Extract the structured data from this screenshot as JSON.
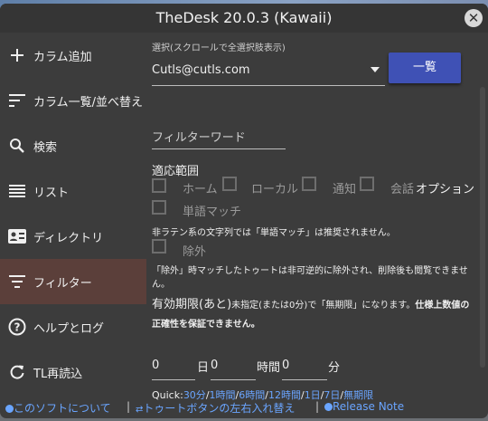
{
  "window": {
    "title": "TheDesk 20.0.3 (Kawaii)",
    "close_symbol": "✕"
  },
  "sidebar": {
    "items": [
      {
        "label": "カラム追加",
        "icon": "plus-icon"
      },
      {
        "label": "カラム一覧/並べ替え",
        "icon": "sort-icon"
      },
      {
        "label": "検索",
        "icon": "search-icon"
      },
      {
        "label": "リスト",
        "icon": "list-icon"
      },
      {
        "label": "ディレクトリ",
        "icon": "contact-card-icon"
      },
      {
        "label": "フィルター",
        "icon": "filter-icon",
        "active": true
      },
      {
        "label": "ヘルプとログ",
        "icon": "help-icon"
      },
      {
        "label": "TL再読込",
        "icon": "refresh-icon"
      }
    ]
  },
  "filter": {
    "select_hint": "選択(スクロールで全選択肢表示)",
    "account_selected": "Cutls@cutls.com",
    "list_button": "一覧",
    "filter_word_placeholder": "フィルターワード",
    "scope_label": "適応範囲",
    "scope_home": "ホーム",
    "scope_local": "ローカル",
    "scope_notify": "通知",
    "scope_conv": "会話",
    "option_label": "オプション",
    "word_match": "単語マッチ",
    "word_match_note": "非ラテン系の文字列では「単語マッチ」は推奨されません。",
    "exclude": "除外",
    "exclude_note": "「除外」時マッチしたトゥートは非可逆的に除外され、削除後も閲覧できません。",
    "expire_label": "有効期限(あと)",
    "expire_note_1": "未指定(または0分)で「無期限」になります。",
    "expire_note_bold": "仕様上数値の正確性を保証できません。",
    "days_value": "0",
    "days_unit": "日",
    "hours_value": "0",
    "hours_unit": "時間",
    "minutes_value": "0",
    "minutes_unit": "分",
    "quick_label": "Quick:",
    "quick_links": [
      "30分",
      "1時間",
      "6時間",
      "12時間",
      "1日",
      "7日",
      "無期限"
    ]
  },
  "footer": {
    "about": "このソフトについて",
    "sep1": "|",
    "toot_swap": "トゥートボタンの左右入れ替え",
    "sep2": "|",
    "release_note": "Release Note"
  },
  "colors": {
    "accent_button": "#3f51b5",
    "active_nav": "#5b3f3a",
    "link": "#6aa5ff"
  }
}
